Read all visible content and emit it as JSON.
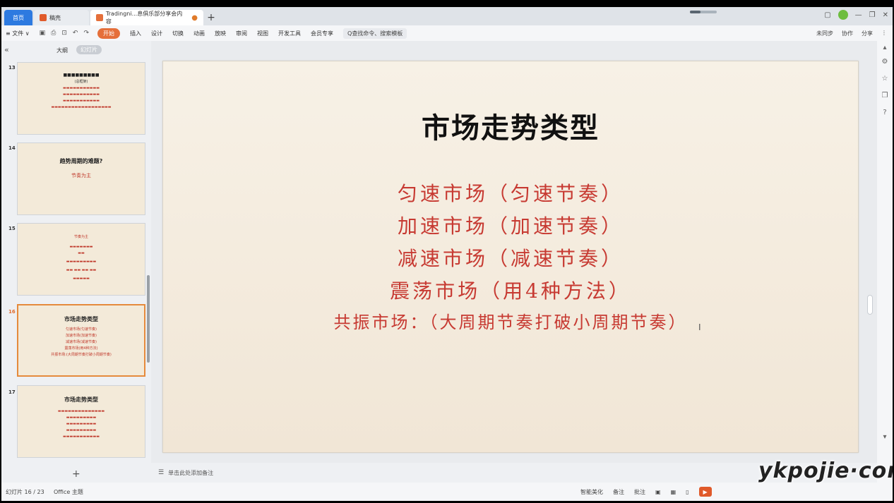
{
  "tabs": {
    "home": "首页",
    "draft": "稿壳",
    "doc": "Tradingni...息俱乐部分享会内容"
  },
  "menubar": {
    "file": "≡ 文件 ∨",
    "start": "开始",
    "items": [
      "插入",
      "设计",
      "切换",
      "动画",
      "放映",
      "审阅",
      "视图",
      "开发工具",
      "会员专享"
    ],
    "search": "Q查找命令、搜索模板",
    "sync": "未同步",
    "collab": "协作",
    "share": "分享"
  },
  "leftpanel": {
    "outline": "大纲",
    "slides": "幻灯片",
    "thumbs": [
      {
        "num": "13",
        "title": "",
        "lines": [
          "(总框架)",
          "",
          "",
          "",
          ""
        ]
      },
      {
        "num": "14",
        "title": "趋势周期的难题?",
        "lines": [
          "节奏为主"
        ]
      },
      {
        "num": "15",
        "title": "节奏为主",
        "lines": [
          "",
          "",
          "",
          "",
          ""
        ]
      },
      {
        "num": "16",
        "title": "市场走势类型",
        "lines": [
          "匀速市场(匀速节奏)",
          "加速市场(加速节奏)",
          "减速市场(减速节奏)",
          "震荡市场(用4种方法)",
          "共振市场:(大周期节奏打破小周期节奏)"
        ]
      },
      {
        "num": "17",
        "title": "市场走势类型",
        "lines": [
          "",
          "",
          "",
          "",
          ""
        ]
      }
    ]
  },
  "slide": {
    "title": "市场走势类型",
    "lines": [
      "匀速市场（匀速节奏）",
      "加速市场（加速节奏）",
      "减速市场（减速节奏）",
      "震荡市场（用4种方法）",
      "共振市场：（大周期节奏打破小周期节奏）"
    ]
  },
  "notes": {
    "placeholder": "单击此处添加备注"
  },
  "statusbar": {
    "slide_counter": "幻灯片 16 / 23",
    "theme": "Office 主题",
    "beautify": "智能美化",
    "notes": "备注",
    "comments": "批注"
  },
  "watermark": "ykpojie·com"
}
